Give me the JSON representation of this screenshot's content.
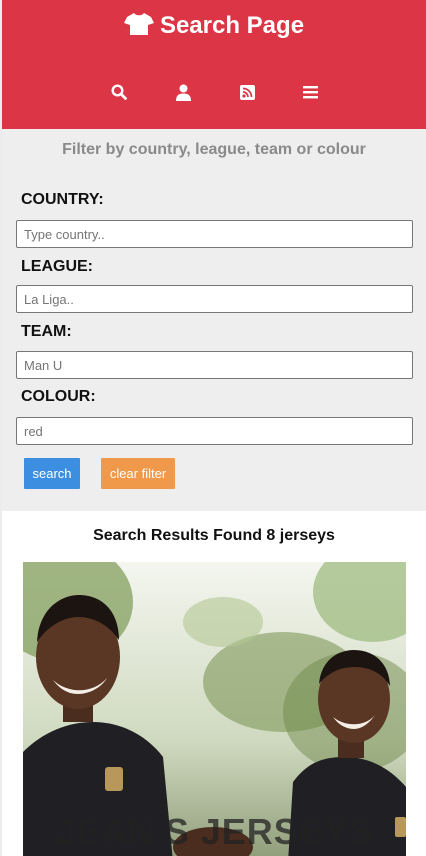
{
  "header": {
    "title": "Search Page",
    "logo_icon": "tshirt-icon",
    "nav": [
      {
        "name": "search-icon"
      },
      {
        "name": "user-icon"
      },
      {
        "name": "rss-icon"
      },
      {
        "name": "menu-icon"
      }
    ]
  },
  "filter": {
    "title": "Filter by country, league, team or colour",
    "country_label": "COUNTRY:",
    "country_placeholder": "Type country..",
    "league_label": "LEAGUE:",
    "league_placeholder": "La Liga..",
    "team_label": "TEAM:",
    "team_placeholder": "Man U",
    "colour_label": "COLOUR:",
    "colour_placeholder": "red",
    "search_label": "search",
    "clear_label": "clear filter"
  },
  "results": {
    "title": "Search Results Found 8 jerseys",
    "image_caption": "JEAN'S JERSEYS"
  },
  "colors": {
    "header": "#dc3545",
    "search_button": "#3c8fe0",
    "clear_button": "#f0994a"
  }
}
